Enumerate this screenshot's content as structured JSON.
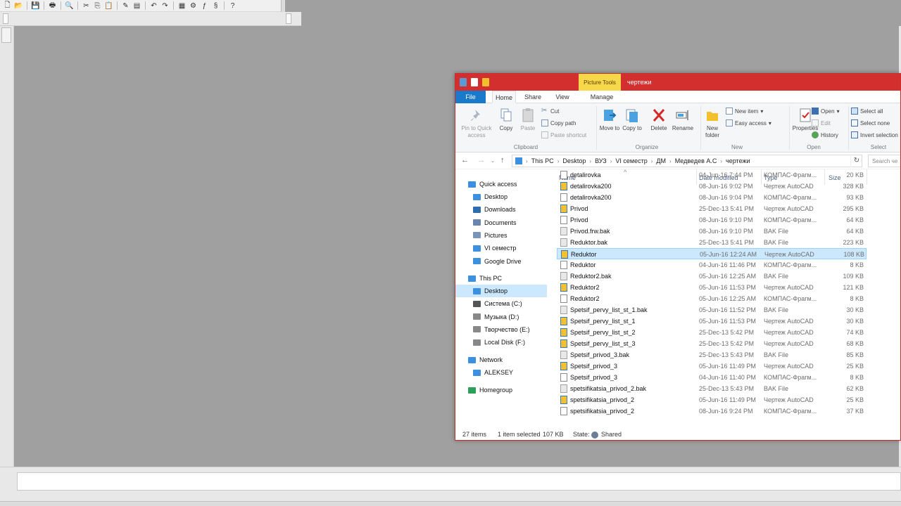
{
  "colors": {
    "title_bar": "#d32f2f",
    "context_tab": "#f7d84a",
    "file_tab": "#1979ca",
    "selection": "#cce8ff",
    "desktop": "#a0a0a0"
  },
  "toolbar_icons": [
    "new-file-icon",
    "open-icon",
    "save-icon",
    "print-icon",
    "preview-icon",
    "cut-icon",
    "copy-icon",
    "paste-icon",
    "properties-icon",
    "manager-icon",
    "undo-icon",
    "redo-icon",
    "spec-icon",
    "library-icon",
    "variables-icon",
    "measure-icon",
    "help-icon"
  ],
  "explorer": {
    "context_tab": "Picture Tools",
    "title": "чертежи",
    "tabs": {
      "file": "File",
      "home": "Home",
      "share": "Share",
      "view": "View",
      "manage": "Manage"
    },
    "ribbon": {
      "pin_label": "Pin to Quick access",
      "copy_label": "Copy",
      "paste_label": "Paste",
      "cut_label": "Cut",
      "copy_path_label": "Copy path",
      "paste_shortcut_label": "Paste shortcut",
      "clipboard_group": "Clipboard",
      "move_to_label": "Move to",
      "copy_to_label": "Copy to",
      "delete_label": "Delete",
      "rename_label": "Rename",
      "organize_group": "Organize",
      "new_folder_label": "New folder",
      "new_item_label": "New item",
      "easy_access_label": "Easy access",
      "new_group": "New",
      "properties_label": "Properties",
      "open_label": "Open",
      "edit_label": "Edit",
      "history_label": "History",
      "open_group": "Open",
      "select_all_label": "Select all",
      "select_none_label": "Select none",
      "invert_selection_label": "Invert selection",
      "select_group": "Select"
    },
    "address": {
      "crumbs": [
        "This PC",
        "Desktop",
        "ВУЗ",
        "VI семестр",
        "ДМ",
        "Медведев А.С",
        "чертежи"
      ],
      "search_placeholder": "Search че"
    },
    "nav": {
      "quick_access": "Quick access",
      "quick_items": [
        "Desktop",
        "Downloads",
        "Documents",
        "Pictures",
        "VI семестр",
        "Google Drive"
      ],
      "this_pc": "This PC",
      "pc_items": [
        "Desktop",
        "Система (C:)",
        "Музыка (D:)",
        "Творчество (E:)",
        "Local Disk (F:)"
      ],
      "network": "Network",
      "network_items": [
        "ALEKSEY"
      ],
      "homegroup": "Homegroup"
    },
    "columns": {
      "name": "Name",
      "date": "Date modified",
      "type": "Type",
      "size": "Size"
    },
    "files": [
      {
        "name": "detalirovka",
        "date": "04-Jun-16 7:44 PM",
        "type": "КОМПАС-Фрагм...",
        "size": "20 KB",
        "icon": "frw-icon"
      },
      {
        "name": "detalirovka200",
        "date": "08-Jun-16 9:02 PM",
        "type": "Чертеж AutoCAD",
        "size": "328 KB",
        "icon": "acad-icon"
      },
      {
        "name": "detalirovka200",
        "date": "08-Jun-16 9:04 PM",
        "type": "КОМПАС-Фрагм...",
        "size": "93 KB",
        "icon": "frw-icon"
      },
      {
        "name": "Privod",
        "date": "25-Dec-13 5:41 PM",
        "type": "Чертеж AutoCAD",
        "size": "295 KB",
        "icon": "acad-icon"
      },
      {
        "name": "Privod",
        "date": "08-Jun-16 9:10 PM",
        "type": "КОМПАС-Фрагм...",
        "size": "64 KB",
        "icon": "frw-icon"
      },
      {
        "name": "Privod.frw.bak",
        "date": "08-Jun-16 9:10 PM",
        "type": "BAK File",
        "size": "64 KB",
        "icon": "bak-icon"
      },
      {
        "name": "Reduktor.bak",
        "date": "25-Dec-13 5:41 PM",
        "type": "BAK File",
        "size": "223 KB",
        "icon": "bak-icon"
      },
      {
        "name": "Reduktor",
        "date": "05-Jun-16 12:24 AM",
        "type": "Чертеж AutoCAD",
        "size": "108 KB",
        "icon": "acad-icon"
      },
      {
        "name": "Reduktor",
        "date": "04-Jun-16 11:46 PM",
        "type": "КОМПАС-Фрагм...",
        "size": "8 KB",
        "icon": "frw-icon"
      },
      {
        "name": "Reduktor2.bak",
        "date": "05-Jun-16 12:25 AM",
        "type": "BAK File",
        "size": "109 KB",
        "icon": "bak-icon"
      },
      {
        "name": "Reduktor2",
        "date": "05-Jun-16 11:53 PM",
        "type": "Чертеж AutoCAD",
        "size": "121 KB",
        "icon": "acad-icon"
      },
      {
        "name": "Reduktor2",
        "date": "05-Jun-16 12:25 AM",
        "type": "КОМПАС-Фрагм...",
        "size": "8 KB",
        "icon": "frw-icon"
      },
      {
        "name": "Spetsif_pervy_list_st_1.bak",
        "date": "05-Jun-16 11:52 PM",
        "type": "BAK File",
        "size": "30 KB",
        "icon": "bak-icon"
      },
      {
        "name": "Spetsif_pervy_list_st_1",
        "date": "05-Jun-16 11:53 PM",
        "type": "Чертеж AutoCAD",
        "size": "30 KB",
        "icon": "acad-icon"
      },
      {
        "name": "Spetsif_pervy_list_st_2",
        "date": "25-Dec-13 5:42 PM",
        "type": "Чертеж AutoCAD",
        "size": "74 KB",
        "icon": "acad-icon"
      },
      {
        "name": "Spetsif_pervy_list_st_3",
        "date": "25-Dec-13 5:42 PM",
        "type": "Чертеж AutoCAD",
        "size": "68 KB",
        "icon": "acad-icon"
      },
      {
        "name": "Spetsif_privod_3.bak",
        "date": "25-Dec-13 5:43 PM",
        "type": "BAK File",
        "size": "85 KB",
        "icon": "bak-icon"
      },
      {
        "name": "Spetsif_privod_3",
        "date": "05-Jun-16 11:49 PM",
        "type": "Чертеж AutoCAD",
        "size": "25 KB",
        "icon": "acad-icon"
      },
      {
        "name": "Spetsif_privod_3",
        "date": "04-Jun-16 11:40 PM",
        "type": "КОМПАС-Фрагм...",
        "size": "8 KB",
        "icon": "frw-icon"
      },
      {
        "name": "spetsifikatsia_privod_2.bak",
        "date": "25-Dec-13 5:43 PM",
        "type": "BAK File",
        "size": "62 KB",
        "icon": "bak-icon"
      },
      {
        "name": "spetsifikatsia_privod_2",
        "date": "05-Jun-16 11:49 PM",
        "type": "Чертеж AutoCAD",
        "size": "25 KB",
        "icon": "acad-icon"
      },
      {
        "name": "spetsifikatsia_privod_2",
        "date": "08-Jun-16 9:24 PM",
        "type": "КОМПАС-Фрагм...",
        "size": "37 KB",
        "icon": "frw-icon"
      }
    ],
    "selected_index": 7,
    "status": {
      "items": "27 items",
      "selected": "1 item selected",
      "size": "107 KB",
      "state_label": "State:",
      "state_value": "Shared"
    }
  }
}
